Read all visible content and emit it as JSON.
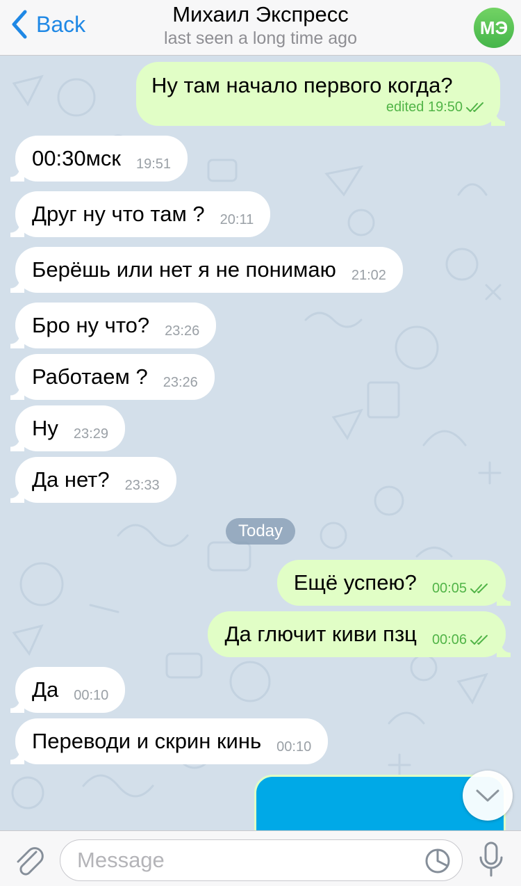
{
  "header": {
    "back_label": "Back",
    "title": "Михаил Экспресс",
    "subtitle": "last seen a long time ago",
    "avatar_initials": "МЭ"
  },
  "messages": [
    {
      "text": "Ну там начало первого когда?",
      "time": "edited 19:50",
      "direction": "out",
      "status": "read"
    },
    {
      "text": "00:30мск",
      "time": "19:51",
      "direction": "in"
    },
    {
      "text": "Друг ну что там ?",
      "time": "20:11",
      "direction": "in"
    },
    {
      "text": "Берёшь или нет я не понимаю",
      "time": "21:02",
      "direction": "in"
    },
    {
      "text": "Бро ну что?",
      "time": "23:26",
      "direction": "in"
    },
    {
      "text": "Работаем ?",
      "time": "23:26",
      "direction": "in"
    },
    {
      "text": "Ну",
      "time": "23:29",
      "direction": "in"
    },
    {
      "text": "Да нет?",
      "time": "23:33",
      "direction": "in"
    },
    {
      "text": "Ещё успею?",
      "time": "00:05",
      "direction": "out",
      "status": "read"
    },
    {
      "text": "Да глючит киви пзц",
      "time": "00:06",
      "direction": "out",
      "status": "read"
    },
    {
      "text": "Да",
      "time": "00:10",
      "direction": "in"
    },
    {
      "text": "Переводи и скрин кинь",
      "time": "00:10",
      "direction": "in"
    }
  ],
  "date_separator": "Today",
  "input": {
    "placeholder": "Message",
    "value": ""
  },
  "icons": {
    "back": "chevron-left-icon",
    "attach": "paperclip-icon",
    "sticker": "sticker-icon",
    "mic": "microphone-icon",
    "scroll": "chevron-down-icon",
    "read": "double-check-icon"
  },
  "colors": {
    "accent": "#1f88e5",
    "outgoing_bubble": "#e1fec6",
    "incoming_bubble": "#ffffff",
    "chat_background": "#d3dfea",
    "read_check": "#51b447",
    "avatar": "#4fbf51",
    "photo_placeholder": "#00a9e7"
  }
}
